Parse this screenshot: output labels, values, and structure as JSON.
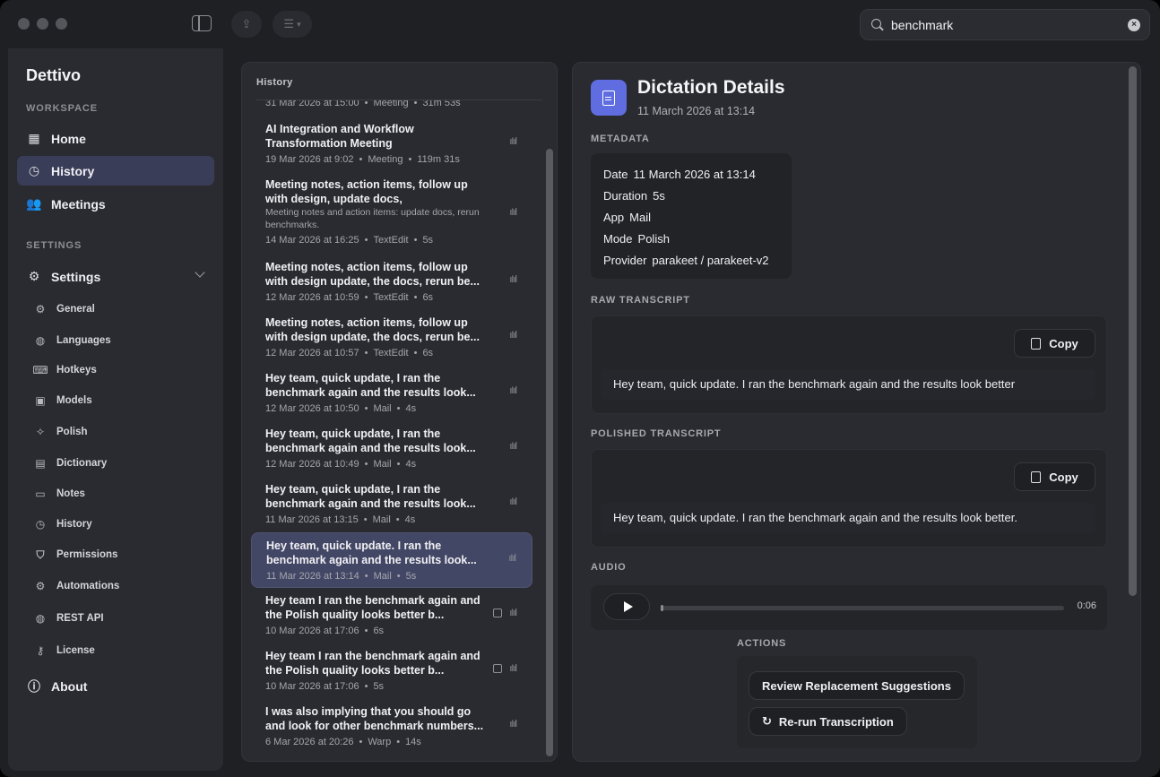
{
  "app": {
    "name": "Dettivo"
  },
  "toolbar": {
    "search_value": "benchmark"
  },
  "sidebar": {
    "workspace_label": "WORKSPACE",
    "workspace_items": [
      {
        "label": "Home",
        "icon": "grid-icon"
      },
      {
        "label": "History",
        "icon": "clock-icon",
        "active": true
      },
      {
        "label": "Meetings",
        "icon": "people-icon"
      }
    ],
    "settings_label": "SETTINGS",
    "settings_item": {
      "label": "Settings",
      "icon": "gear-icon"
    },
    "settings_subitems": [
      {
        "label": "General",
        "icon": "gear-icon"
      },
      {
        "label": "Languages",
        "icon": "globe-icon"
      },
      {
        "label": "Hotkeys",
        "icon": "keyboard-icon"
      },
      {
        "label": "Models",
        "icon": "chip-icon"
      },
      {
        "label": "Polish",
        "icon": "wand-icon"
      },
      {
        "label": "Dictionary",
        "icon": "book-icon"
      },
      {
        "label": "Notes",
        "icon": "note-icon"
      },
      {
        "label": "History",
        "icon": "clock-icon"
      },
      {
        "label": "Permissions",
        "icon": "shield-icon"
      },
      {
        "label": "Automations",
        "icon": "gears-icon"
      },
      {
        "label": "REST API",
        "icon": "globe-icon"
      },
      {
        "label": "License",
        "icon": "key-icon"
      }
    ],
    "about": {
      "label": "About",
      "icon": "info-icon"
    }
  },
  "history": {
    "title": "History",
    "items": [
      {
        "title": "",
        "preview": "",
        "date": "31 Mar 2026 at 15:00",
        "app": "Meeting",
        "duration": "31m 53s"
      },
      {
        "title": "AI Integration and Workflow Transformation Meeting",
        "preview": "",
        "date": "19 Mar 2026 at 9:02",
        "app": "Meeting",
        "duration": "119m 31s"
      },
      {
        "title": "Meeting notes, action items, follow up with design, update docs,",
        "preview": "Meeting notes and action items: update docs, rerun benchmarks.",
        "date": "14 Mar 2026 at 16:25",
        "app": "TextEdit",
        "duration": "5s"
      },
      {
        "title": "Meeting notes, action items, follow up with design update, the docs, rerun be...",
        "preview": "",
        "date": "12 Mar 2026 at 10:59",
        "app": "TextEdit",
        "duration": "6s"
      },
      {
        "title": "Meeting notes, action items, follow up with design update, the docs, rerun be...",
        "preview": "",
        "date": "12 Mar 2026 at 10:57",
        "app": "TextEdit",
        "duration": "6s"
      },
      {
        "title": "Hey team, quick update, I ran the benchmark again and the results look...",
        "preview": "",
        "date": "12 Mar 2026 at 10:50",
        "app": "Mail",
        "duration": "4s"
      },
      {
        "title": "Hey team, quick update, I ran the benchmark again and the results look...",
        "preview": "",
        "date": "12 Mar 2026 at 10:49",
        "app": "Mail",
        "duration": "4s"
      },
      {
        "title": "Hey team, quick update, I ran the benchmark again and the results look...",
        "preview": "",
        "date": "11 Mar 2026 at 13:15",
        "app": "Mail",
        "duration": "4s"
      },
      {
        "title": "Hey team, quick update. I ran the benchmark again and the results look...",
        "preview": "",
        "date": "11 Mar 2026 at 13:14",
        "app": "Mail",
        "duration": "5s",
        "selected": true
      },
      {
        "title": "Hey team I ran the benchmark again and the Polish quality looks better b...",
        "preview": "",
        "date": "10 Mar 2026 at 17:06",
        "app": "",
        "duration": "6s"
      },
      {
        "title": "Hey team I ran the benchmark again and the Polish quality looks better b...",
        "preview": "",
        "date": "10 Mar 2026 at 17:06",
        "app": "",
        "duration": "5s"
      },
      {
        "title": "I was also implying that you should go and look for other benchmark numbers...",
        "preview": "",
        "date": "6 Mar 2026 at 20:26",
        "app": "Warp",
        "duration": "14s"
      }
    ]
  },
  "detail": {
    "title": "Dictation Details",
    "subtitle": "11 March 2026 at 13:14",
    "metadata_label": "METADATA",
    "metadata": [
      {
        "key": "Date",
        "value": "11 March 2026 at 13:14"
      },
      {
        "key": "Duration",
        "value": "5s"
      },
      {
        "key": "App",
        "value": "Mail"
      },
      {
        "key": "Mode",
        "value": "Polish"
      },
      {
        "key": "Provider",
        "value": "parakeet / parakeet-v2"
      }
    ],
    "raw_label": "RAW TRANSCRIPT",
    "raw_text": "Hey team, quick update. I ran the benchmark again and the results look better",
    "polished_label": "POLISHED TRANSCRIPT",
    "polished_text": "Hey team, quick update. I ran the benchmark again and the results look better.",
    "copy_label": "Copy",
    "audio_label": "AUDIO",
    "audio_time": "0:06",
    "audio_progress": 0.0,
    "actions_label": "ACTIONS",
    "review_label": "Review Replacement Suggestions",
    "rerun_label": "Re-run Transcription"
  }
}
